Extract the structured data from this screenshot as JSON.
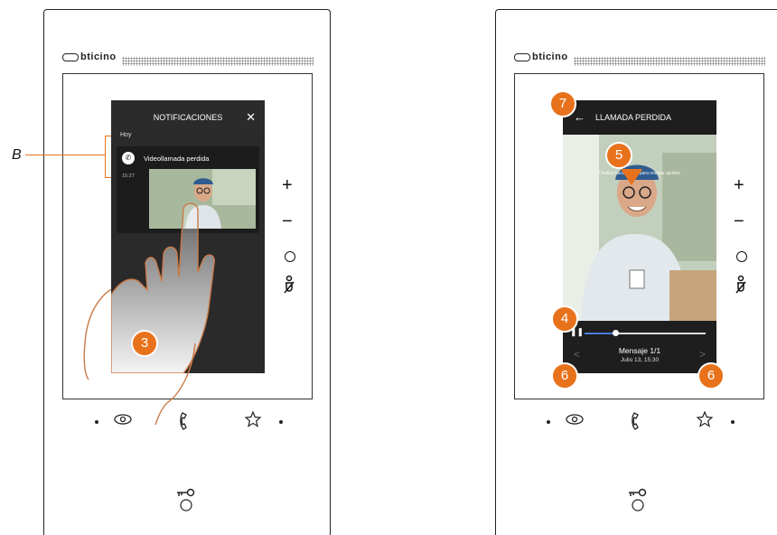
{
  "brand": "bticino",
  "panel_left": {
    "header_title": "NOTIFICACIONES",
    "close_glyph": "✕",
    "section_label": "Hoy",
    "notification_title": "Videollamada perdida",
    "notification_time": "15:27",
    "callout_label": "B",
    "step_badge": "3"
  },
  "panel_right": {
    "header_title": "LLAMADA PERDIDA",
    "back_glyph": "←",
    "hint_text": "Desliza hacia abajo para realizar ajustes",
    "message_label": "Mensaje 1/1",
    "message_date": "Julio 13, 15:30",
    "prev_glyph": "<",
    "next_glyph": ">",
    "playback_progress": 0.25,
    "badges": {
      "back": "7",
      "video": "5",
      "progress": "4",
      "prev": "6",
      "next": "6"
    }
  },
  "side_controls": {
    "plus": "+",
    "minus": "−"
  },
  "colors": {
    "accent": "#e8721c",
    "screen": "#2a2a2a",
    "progress": "#4a7bd8"
  }
}
